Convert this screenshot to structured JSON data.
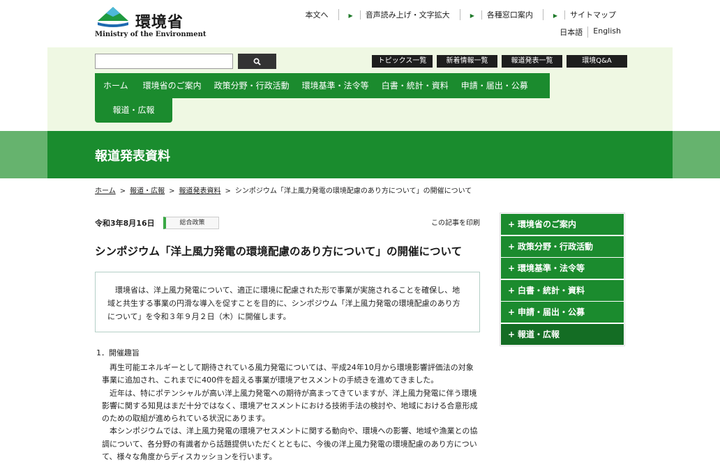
{
  "header": {
    "logo_ja": "環境省",
    "logo_en": "Ministry of the Environment",
    "util_links": [
      "本文へ",
      "音声読み上げ・文字拡大",
      "各種窓口案内",
      "サイトマップ"
    ],
    "lang_links": [
      "日本語",
      "English"
    ]
  },
  "search": {
    "placeholder": "",
    "button_icon": "search-icon"
  },
  "quick_links": [
    "トピックス一覧",
    "新着情報一覧",
    "報道発表一覧",
    "環境Q&A"
  ],
  "main_nav": [
    "ホーム",
    "環境省のご案内",
    "政策分野・行政活動",
    "環境基準・法令等",
    "白書・統計・資料",
    "申請・届出・公募",
    "報道・広報"
  ],
  "page_title": "報道発表資料",
  "breadcrumb": [
    "ホーム",
    "報道・広報",
    "報道発表資料",
    "シンポジウム「洋上風力発電の環境配慮のあり方について」の開催について"
  ],
  "article": {
    "date": "令和3年8月16日",
    "category": "総合政策",
    "print": "この記事を印刷",
    "title": "シンポジウム「洋上風力発電の環境配慮のあり方について」の開催について",
    "summary": "環境省は、洋上風力発電について、適正に環境に配慮された形で事業が実施されることを確保し、地域と共生する事業の円滑な導入を促すことを目的に、シンポジウム「洋上風力発電の環境配慮のあり方について」を令和３年９月２日（木）に開催します。",
    "section_heading": "1．開催趣旨",
    "paragraphs": [
      "再生可能エネルギーとして期待されている風力発電については、平成24年10月から環境影響評価法の対象事業に追加され、これまでに400件を超える事業が環境アセスメントの手続きを進めてきました。",
      "近年は、特にポテンシャルが高い洋上風力発電への期待が高まってきていますが、洋上風力発電に伴う環境影響に関する知見はまだ十分ではなく、環境アセスメントにおける技術手法の検討や、地域における合意形成のための取組が進められている状況にあります。",
      "本シンポジウムでは、洋上風力発電の環境アセスメントに関する動向や、環境への影響、地域や漁業との協調について、各分野の有識者から話題提供いただくとともに、今後の洋上風力発電の環境配慮のあり方について、様々な角度からディスカッションを行います。"
    ]
  },
  "side_nav": [
    "環境省のご案内",
    "政策分野・行政活動",
    "環境基準・法令等",
    "白書・統計・資料",
    "申請・届出・公募",
    "報道・広報"
  ],
  "colors": {
    "brand_green": "#1b8b2e",
    "light_green": "#eff8e3",
    "band_green": "#66b36e"
  }
}
